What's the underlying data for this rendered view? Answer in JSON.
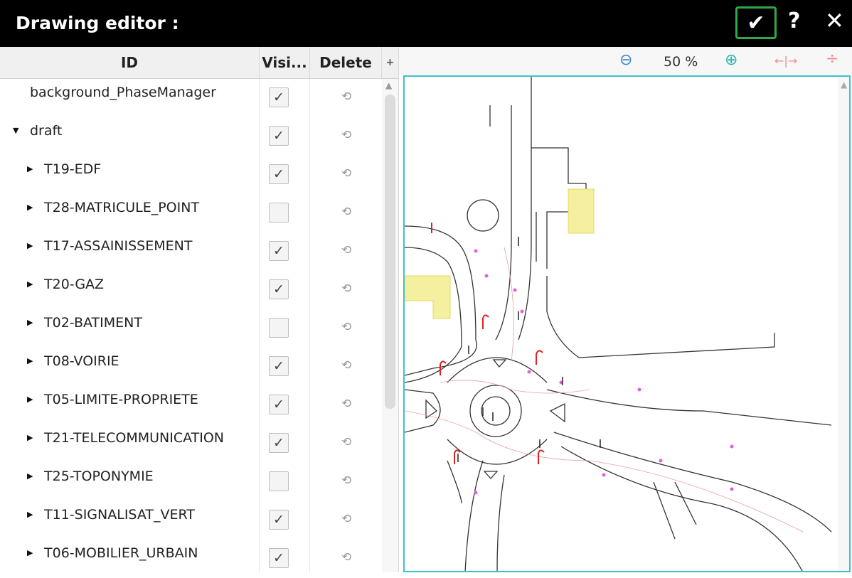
{
  "window": {
    "title": "Drawing editor :",
    "ok_glyph": "✔",
    "help_glyph": "?",
    "close_glyph": "✕"
  },
  "layer_table": {
    "columns": {
      "id": "ID",
      "visible": "Visi...",
      "delete": "Delete",
      "add": "+"
    },
    "rows": [
      {
        "label": "background_PhaseManager",
        "visible": true,
        "level": 0,
        "expander": "none"
      },
      {
        "label": "draft",
        "visible": true,
        "level": 0,
        "expander": "expanded"
      },
      {
        "label": "T19-EDF",
        "visible": true,
        "level": 1,
        "expander": "collapsed"
      },
      {
        "label": "T28-MATRICULE_POINT",
        "visible": false,
        "level": 1,
        "expander": "collapsed"
      },
      {
        "label": "T17-ASSAINISSEMENT",
        "visible": true,
        "level": 1,
        "expander": "collapsed"
      },
      {
        "label": "T20-GAZ",
        "visible": true,
        "level": 1,
        "expander": "collapsed"
      },
      {
        "label": "T02-BATIMENT",
        "visible": false,
        "level": 1,
        "expander": "collapsed"
      },
      {
        "label": "T08-VOIRIE",
        "visible": true,
        "level": 1,
        "expander": "collapsed"
      },
      {
        "label": "T05-LIMITE-PROPRIETE",
        "visible": true,
        "level": 1,
        "expander": "collapsed"
      },
      {
        "label": "T21-TELECOMMUNICATION",
        "visible": true,
        "level": 1,
        "expander": "collapsed"
      },
      {
        "label": "T25-TOPONYMIE",
        "visible": false,
        "level": 1,
        "expander": "collapsed"
      },
      {
        "label": "T11-SIGNALISAT_VERT",
        "visible": true,
        "level": 1,
        "expander": "collapsed"
      },
      {
        "label": "T06-MOBILIER_URBAIN",
        "visible": true,
        "level": 1,
        "expander": "collapsed"
      }
    ],
    "glyphs": {
      "check": "✓",
      "delete": "⟲",
      "expanded": "▼",
      "collapsed": "▶"
    }
  },
  "viewer": {
    "zoom_out_icon": "⊖",
    "zoom_level": "50 %",
    "zoom_in_icon": "⊕",
    "fit_width_glyph": "←|→",
    "fit_height_glyph": "÷"
  },
  "colors": {
    "titlebar": "#000000",
    "ok_border": "#2fa84a",
    "canvas_border": "#3fc2c8"
  }
}
